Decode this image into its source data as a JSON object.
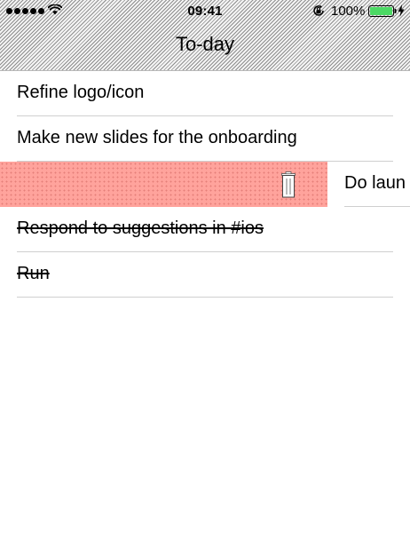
{
  "status_bar": {
    "time": "09:41",
    "battery_percent": "100%"
  },
  "nav": {
    "title": "To-day"
  },
  "tasks": [
    {
      "text": "Refine logo/icon",
      "done": false
    },
    {
      "text": "Make new slides for the onboarding",
      "done": false
    },
    {
      "text": "Do laun",
      "done": false,
      "swiped": true,
      "action_icon": "trash-icon"
    },
    {
      "text": "Respond to suggestions in #ios",
      "done": true
    },
    {
      "text": "Run",
      "done": true
    }
  ],
  "colors": {
    "delete_background": "#ffa39c",
    "battery_fill": "#4cd964",
    "separator": "#cfcfcf"
  }
}
